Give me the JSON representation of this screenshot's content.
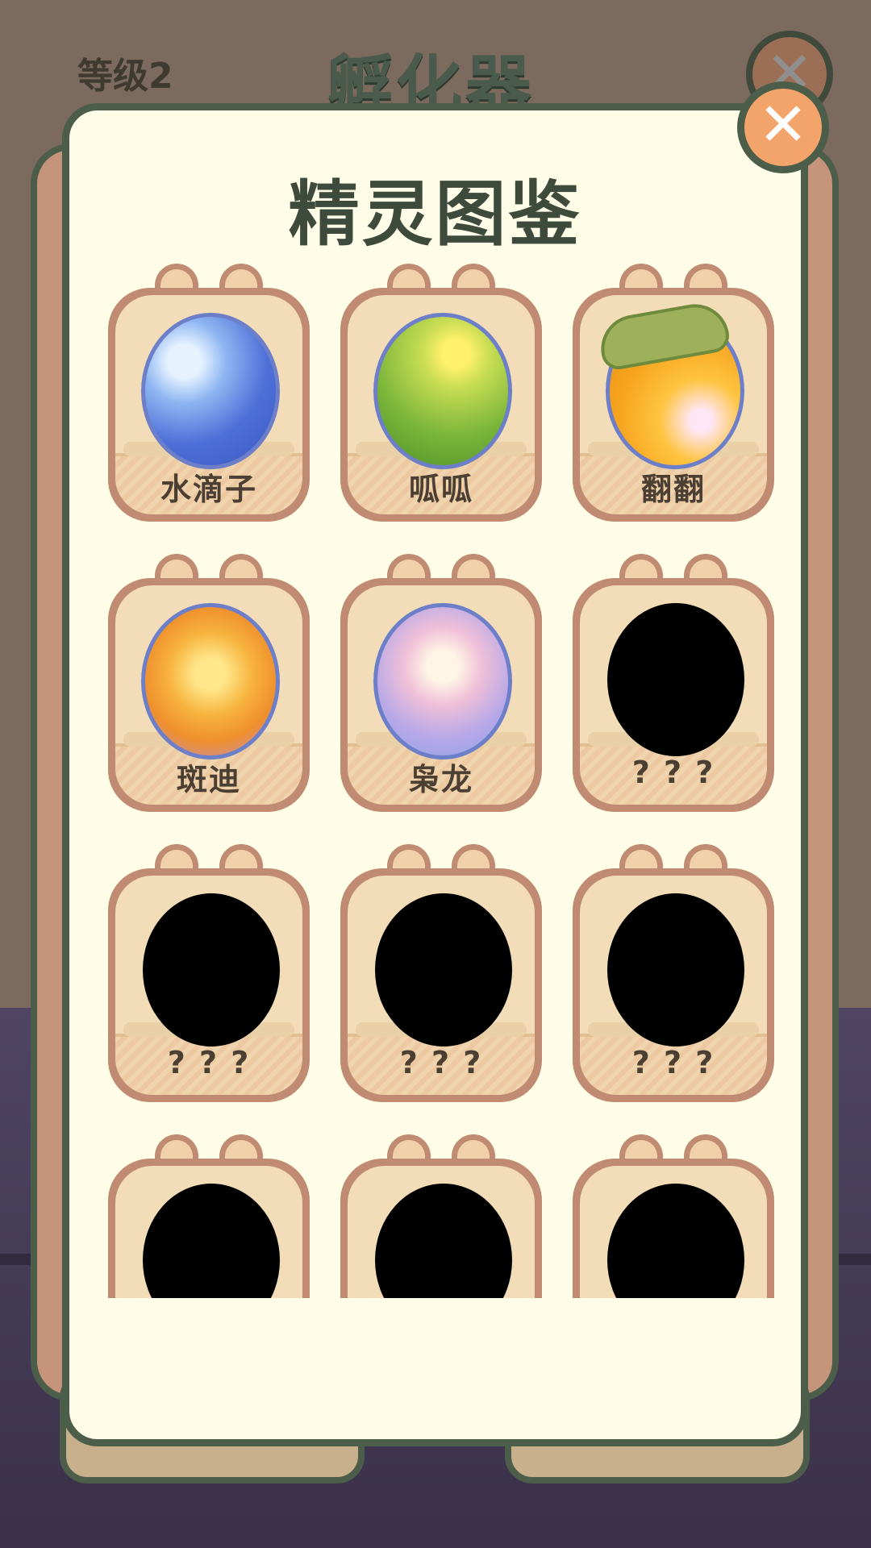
{
  "background": {
    "level_label": "等级2",
    "title": "孵化器"
  },
  "modal": {
    "title": "精灵图鉴",
    "close_icon": "close-icon"
  },
  "spirits": [
    {
      "name": "水滴子",
      "egg": "water-egg"
    },
    {
      "name": "呱呱",
      "egg": "grass-egg"
    },
    {
      "name": "翻翻",
      "egg": "leaf-egg"
    },
    {
      "name": "斑迪",
      "egg": "flame-egg"
    },
    {
      "name": "枭龙",
      "egg": "dream-egg"
    },
    {
      "name": "? ? ?",
      "egg": "unknown-egg"
    },
    {
      "name": "? ? ?",
      "egg": "unknown-egg"
    },
    {
      "name": "? ? ?",
      "egg": "unknown-egg"
    },
    {
      "name": "? ? ?",
      "egg": "unknown-egg"
    },
    {
      "name": "",
      "egg": "unknown-egg"
    },
    {
      "name": "",
      "egg": "unknown-egg"
    },
    {
      "name": "",
      "egg": "unknown-egg"
    }
  ]
}
